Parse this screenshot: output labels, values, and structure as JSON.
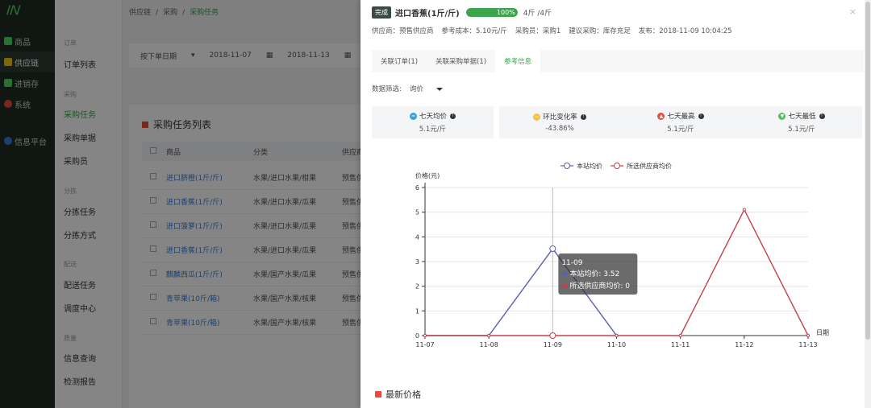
{
  "nav": {
    "items": [
      {
        "label": "商品",
        "color": "#4cd964"
      },
      {
        "label": "供应链",
        "color": "#f1c40f"
      },
      {
        "label": "进销存",
        "color": "#4cd964"
      },
      {
        "label": "系统",
        "color": "#e74c3c"
      },
      {
        "label": "信息平台",
        "color": "#3a7bd5"
      }
    ]
  },
  "subnav": {
    "groups": [
      {
        "title": "订单",
        "links": [
          "订单列表"
        ]
      },
      {
        "title": "采购",
        "links": [
          "采购任务",
          "采购单据",
          "采购员"
        ]
      },
      {
        "title": "分拣",
        "links": [
          "分拣任务",
          "分拣方式"
        ]
      },
      {
        "title": "配送",
        "links": [
          "配送任务",
          "调度中心"
        ]
      },
      {
        "title": "质量",
        "links": [
          "信息查询",
          "检测报告"
        ]
      }
    ]
  },
  "breadcrumb": [
    "供应链",
    "/",
    "采购",
    "/",
    "采购任务"
  ],
  "filter": {
    "date_type": "按下单日期",
    "start": "2018-11-07",
    "end": "2018-11-13"
  },
  "task_list": {
    "title": "采购任务列表",
    "columns": [
      "商品",
      "分类",
      "供应商"
    ],
    "rows": [
      {
        "name": "进口脐橙(1斤/斤)",
        "cat": "水果/进口水果/柑果",
        "sup": "预售供"
      },
      {
        "name": "进口香蕉(1斤/斤)",
        "cat": "水果/进口水果/瓜果",
        "sup": "预售供"
      },
      {
        "name": "进口菠萝(1斤/斤)",
        "cat": "水果/进口水果/瓜果",
        "sup": "预售供"
      },
      {
        "name": "进口香蕉(1斤/斤)",
        "cat": "水果/进口水果/瓜果",
        "sup": "预售供"
      },
      {
        "name": "麒麟西瓜(1斤/斤)",
        "cat": "水果/国产水果/瓜果",
        "sup": "预售供"
      },
      {
        "name": "青苹果(10斤/箱)",
        "cat": "水果/国产水果/核果",
        "sup": "预售供"
      },
      {
        "name": "青苹果(10斤/箱)",
        "cat": "水果/国产水果/核果",
        "sup": "预售供"
      }
    ]
  },
  "drawer": {
    "badge": "完成",
    "title": "进口香蕉(1斤/斤)",
    "progress": {
      "percent": 100,
      "label": "100%"
    },
    "qty": "4斤 /4斤",
    "close": "×",
    "info": [
      "供应商：预售供应商",
      "参考成本：5.10元/斤",
      "采购员：采购1",
      "建议采购：库存充足",
      "发布：2018-11-09 10:04:25"
    ],
    "tabs": [
      "关联订单(1)",
      "关联采购单据(1)",
      "参考信息"
    ],
    "active_tab": 2,
    "data_filter": {
      "label": "数据筛选:",
      "value": "询价"
    },
    "stats": [
      {
        "label": "七天均价",
        "value": "5.1元/斤",
        "color": "#3aa1e0"
      },
      {
        "label": "环比变化率",
        "value": "-43.86%",
        "color": "#f5c242"
      },
      {
        "label": "七天最高",
        "value": "5.1元/斤",
        "color": "#e74c3c"
      },
      {
        "label": "七天最低",
        "value": "5.1元/斤",
        "color": "#4cbf5a"
      }
    ],
    "latest_title": "最新价格"
  },
  "chart_data": {
    "type": "line",
    "categories": [
      "11-07",
      "11-08",
      "11-09",
      "11-10",
      "11-11",
      "11-12",
      "11-13"
    ],
    "series": [
      {
        "name": "本站均价",
        "values": [
          0,
          0,
          3.52,
          0,
          null,
          null,
          null
        ],
        "color": "#5b5fb0"
      },
      {
        "name": "所选供应商均价",
        "values": [
          0,
          0,
          0,
          0,
          0,
          5.1,
          0
        ],
        "color": "#c0434b"
      }
    ],
    "ylabel": "价格(元)",
    "xlabel": "日期",
    "ylim": [
      0,
      6
    ],
    "yticks": [
      0,
      1,
      2,
      3,
      4,
      5,
      6
    ],
    "grid": true,
    "legend": "top-center",
    "tooltip": {
      "title": "11-09",
      "lines": [
        "本站均价: 3.52",
        "所选供应商均价: 0"
      ]
    }
  }
}
